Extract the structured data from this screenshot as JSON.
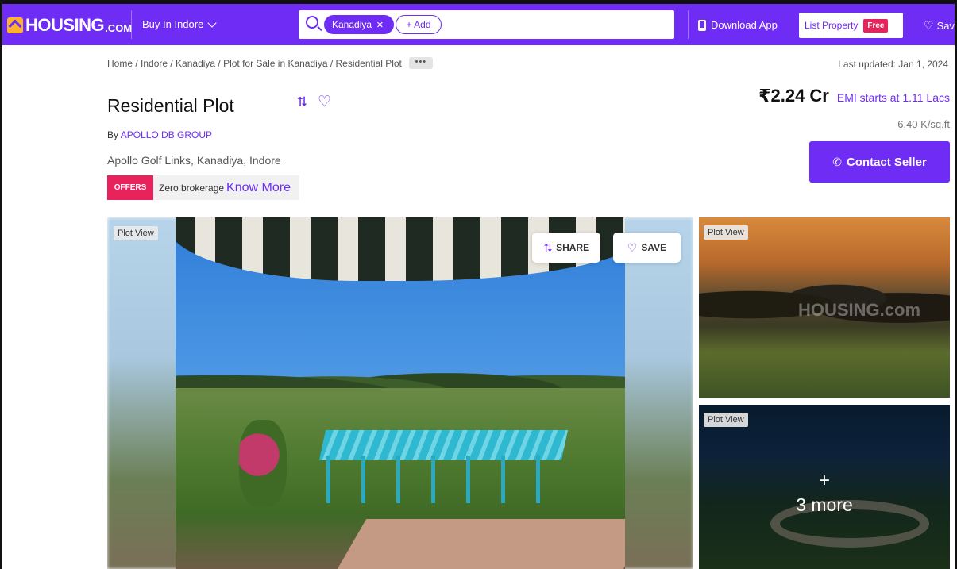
{
  "header": {
    "logo_text": "HOUSING",
    "logo_suffix": ".COM",
    "buy_menu_label": "Buy In Indore",
    "search_chip": "Kanadiya",
    "add_chip": "+ Add",
    "download_app": "Download App",
    "list_property": "List Property",
    "free_badge": "Free",
    "saved": "Sav"
  },
  "breadcrumb": {
    "text": "Home / Indore / Kanadiya / Plot for Sale in Kanadiya / Residential Plot",
    "more": "•••"
  },
  "last_updated": "Last updated: Jan 1, 2024",
  "listing": {
    "title": "Residential Plot",
    "by_prefix": "By",
    "developer": "APOLLO DB GROUP",
    "address": "Apollo Golf Links, Kanadiya, Indore",
    "offer_tag": "OFFERS",
    "offer_text": "Zero brokerage",
    "offer_link": "Know More"
  },
  "price": {
    "value": "₹2.24 Cr",
    "emi_prefix": "EMI starts at",
    "emi_value": "1.11 Lacs",
    "per_sqft": "6.40 K/sq.ft",
    "contact_button": "Contact Seller"
  },
  "gallery": {
    "main_tag": "Plot View",
    "share_label": "SHARE",
    "save_label": "SAVE",
    "side1_tag": "Plot View",
    "side2_tag": "Plot View",
    "more_plus": "+",
    "more_label": "3 more",
    "watermark": "HOUSING.com"
  },
  "colors": {
    "brand_purple": "#6e2cf4",
    "offer_pink": "#e8225b",
    "logo_yellow": "#ffb22c"
  },
  "icons": [
    "housing-logo-icon",
    "chevron-down-icon",
    "search-icon",
    "close-icon",
    "phone-icon",
    "heart-icon",
    "share-icon",
    "call-icon"
  ]
}
